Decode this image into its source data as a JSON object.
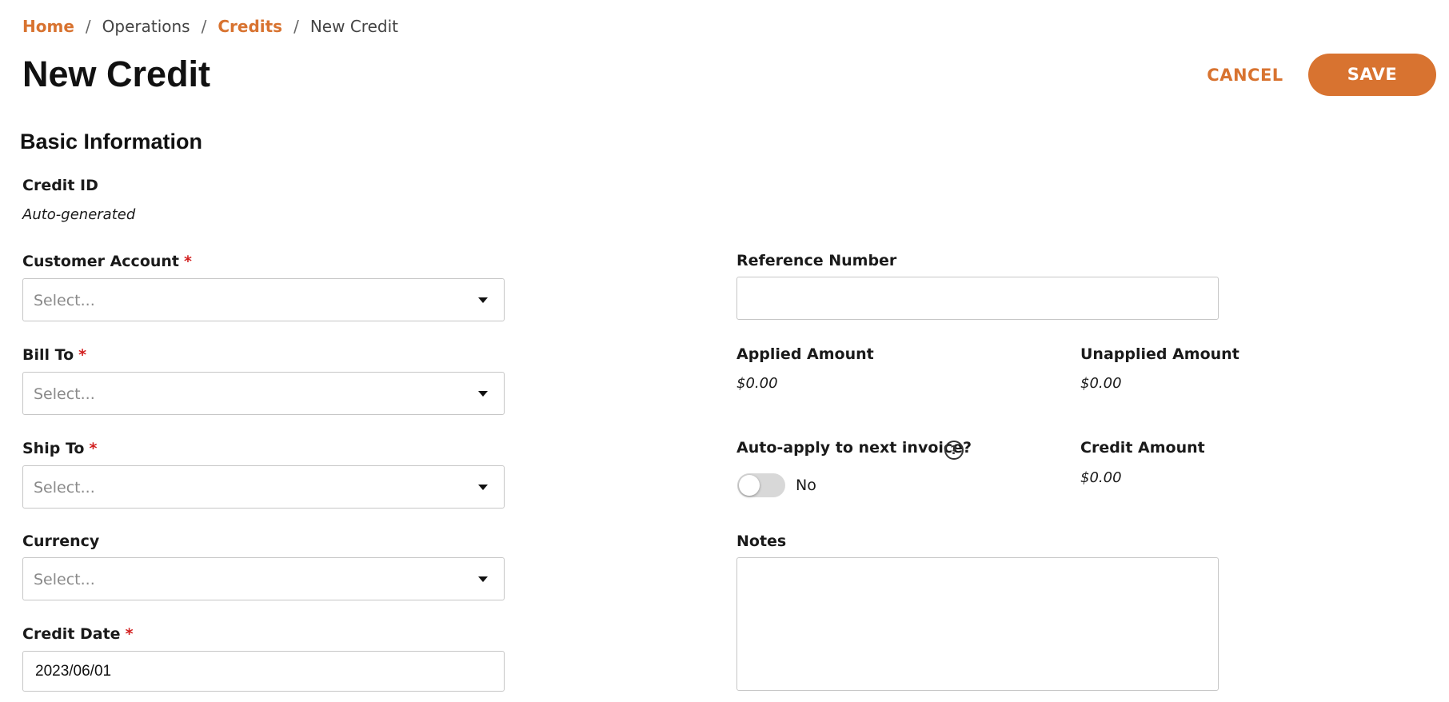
{
  "breadcrumb": {
    "home": "Home",
    "operations": "Operations",
    "credits": "Credits",
    "current": "New Credit",
    "separator": "/"
  },
  "page_title": "New Credit",
  "actions": {
    "cancel": "CANCEL",
    "save": "SAVE"
  },
  "section_title": "Basic Information",
  "required_mark": "*",
  "fields": {
    "credit_id": {
      "label": "Credit ID",
      "value": "Auto-generated"
    },
    "customer_account": {
      "label": "Customer Account",
      "placeholder": "Select..."
    },
    "bill_to": {
      "label": "Bill To",
      "placeholder": "Select..."
    },
    "ship_to": {
      "label": "Ship To",
      "placeholder": "Select..."
    },
    "currency": {
      "label": "Currency",
      "placeholder": "Select..."
    },
    "credit_date": {
      "label": "Credit Date",
      "value": "2023/06/01"
    },
    "reference_number": {
      "label": "Reference Number",
      "value": ""
    },
    "applied_amount": {
      "label": "Applied Amount",
      "value": "$0.00"
    },
    "unapplied_amount": {
      "label": "Unapplied Amount",
      "value": "$0.00"
    },
    "auto_apply": {
      "label": "Auto-apply to next invoice?",
      "help": "?",
      "state": "No",
      "enabled": false
    },
    "credit_amount": {
      "label": "Credit Amount",
      "value": "$0.00"
    },
    "notes": {
      "label": "Notes",
      "value": ""
    }
  },
  "colors": {
    "accent": "#d87330",
    "required": "#d21f1f",
    "border": "#c6c6c6",
    "toggle_off": "#d8d8d8"
  }
}
